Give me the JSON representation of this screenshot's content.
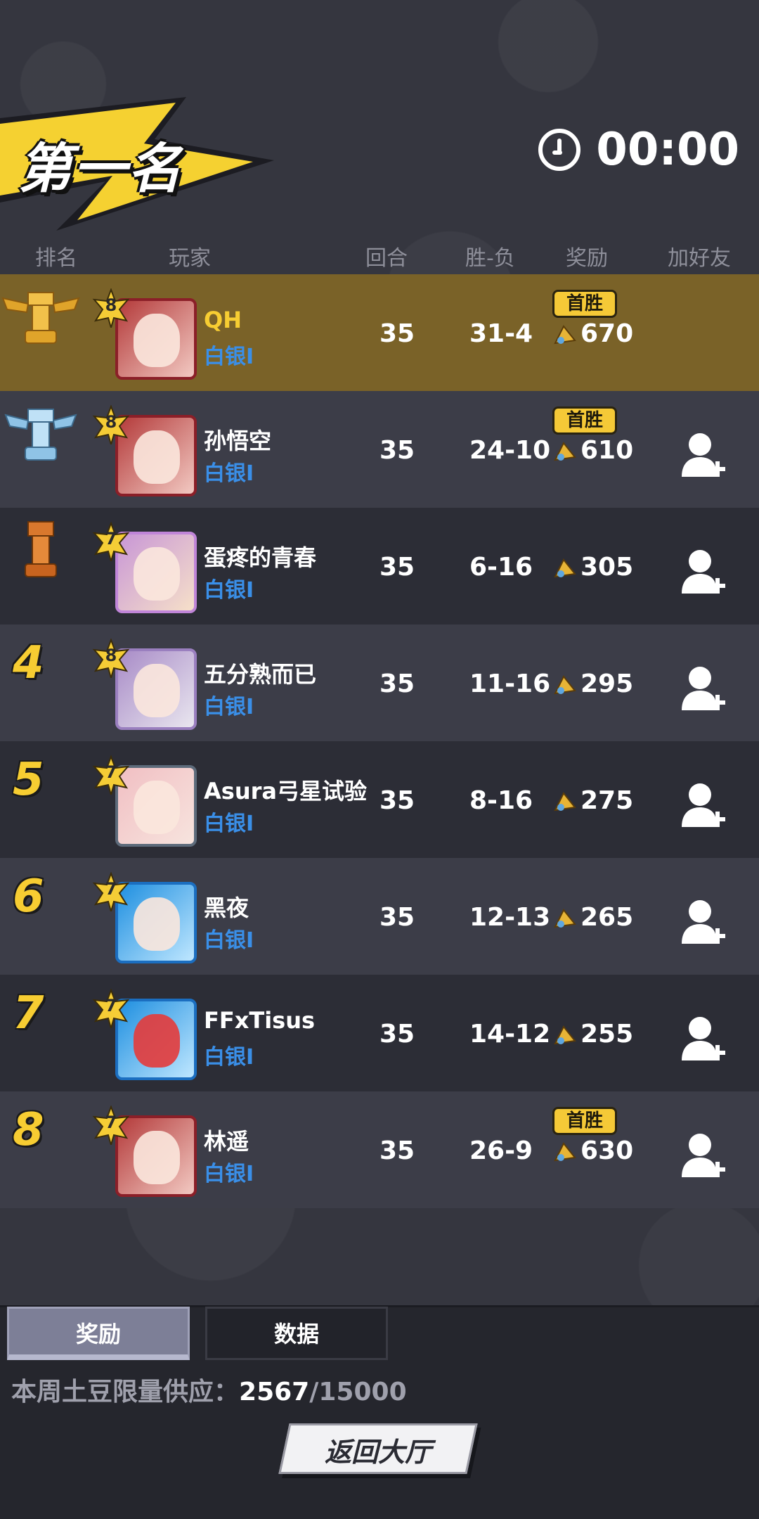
{
  "header": {
    "title": "第一名",
    "timer": "00:00"
  },
  "columns": {
    "rank": "排名",
    "player": "玩家",
    "rounds": "回合",
    "record": "胜-负",
    "reward": "奖励",
    "add_friend": "加好友"
  },
  "rows": [
    {
      "rank": "1",
      "level": "8",
      "name": "QH",
      "tier": "白银I",
      "rounds": "35",
      "record": "31-4",
      "reward": "670",
      "first_win": "首胜"
    },
    {
      "rank": "2",
      "level": "8",
      "name": "孙悟空",
      "tier": "白银I",
      "rounds": "35",
      "record": "24-10",
      "reward": "610",
      "first_win": "首胜"
    },
    {
      "rank": "3",
      "level": "7",
      "name": "蛋疼的青春",
      "tier": "白银I",
      "rounds": "35",
      "record": "6-16",
      "reward": "305"
    },
    {
      "rank": "4",
      "level": "8",
      "name": "五分熟而已",
      "tier": "白银I",
      "rounds": "35",
      "record": "11-16",
      "reward": "295"
    },
    {
      "rank": "5",
      "level": "7",
      "name": "Asura弓星试验",
      "tier": "白银I",
      "rounds": "35",
      "record": "8-16",
      "reward": "275"
    },
    {
      "rank": "6",
      "level": "7",
      "name": "黑夜",
      "tier": "白银I",
      "rounds": "35",
      "record": "12-13",
      "reward": "265"
    },
    {
      "rank": "7",
      "level": "7",
      "name": "FFxTisus",
      "tier": "白银I",
      "rounds": "35",
      "record": "14-12",
      "reward": "255"
    },
    {
      "rank": "8",
      "level": "7",
      "name": "林遥",
      "tier": "白银I",
      "rounds": "35",
      "record": "26-9",
      "reward": "630",
      "first_win": "首胜"
    }
  ],
  "tabs": {
    "rewards": "奖励",
    "data": "数据"
  },
  "supply": {
    "label": "本周土豆限量供应：",
    "current": "2567",
    "total": "/15000"
  },
  "return_button": "返回大厅",
  "colors": {
    "background": "#35363f",
    "first_row": "#7a6228",
    "gold": "#f7cd32",
    "tier_blue": "#3a8fe8"
  },
  "icons": [
    "clock-icon",
    "gold-trophy-icon",
    "silver-trophy-icon",
    "bronze-trophy-icon",
    "level-star-icon",
    "coin-icon",
    "add-friend-icon"
  ]
}
